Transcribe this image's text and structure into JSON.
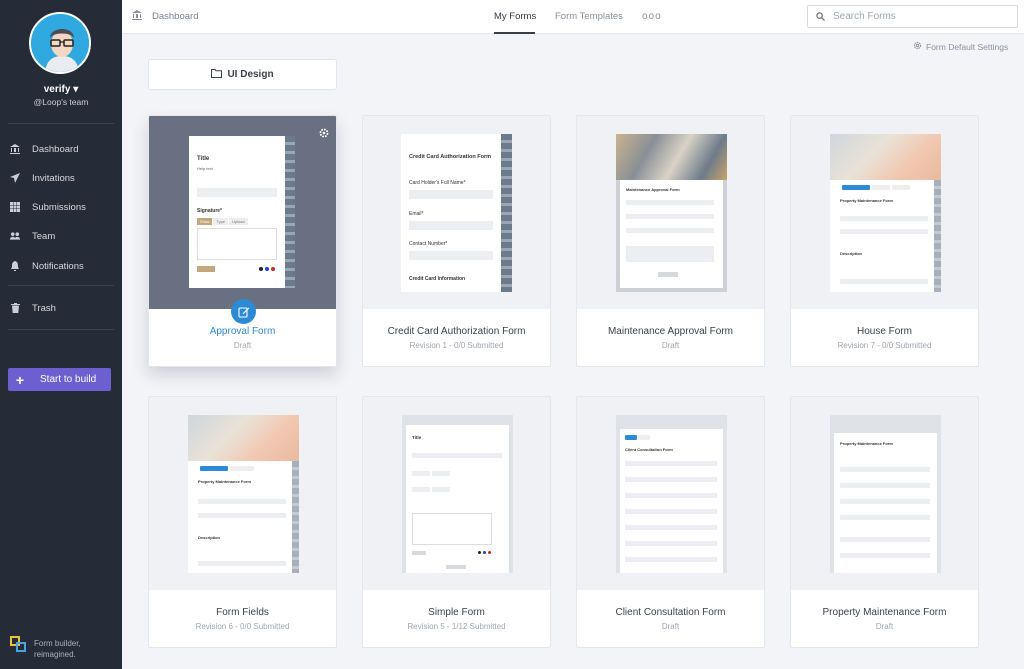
{
  "sidebar": {
    "user_name": "verify",
    "team": "@Loop's team",
    "nav": [
      {
        "label": "Dashboard",
        "icon": "bank-icon"
      },
      {
        "label": "Invitations",
        "icon": "paper-plane-icon"
      },
      {
        "label": "Submissions",
        "icon": "grid-icon"
      },
      {
        "label": "Team",
        "icon": "users-icon"
      },
      {
        "label": "Notifications",
        "icon": "bell-icon"
      },
      {
        "label": "Trash",
        "icon": "trash-icon"
      }
    ],
    "start_button": "Start to build",
    "brand_text_line1": "Form builder,",
    "brand_text_line2": "reimagined."
  },
  "topbar": {
    "breadcrumb": "Dashboard",
    "tabs": [
      "My Forms",
      "Form Templates"
    ],
    "active_tab": "My Forms",
    "more": "ooo",
    "search_placeholder": "Search Forms"
  },
  "toolbar": {
    "defaults_label": "Form Default Settings",
    "folder_label": "UI Design"
  },
  "forms": [
    {
      "title": "Approval Form",
      "subtitle": "Draft"
    },
    {
      "title": "Credit Card Authorization Form",
      "subtitle": "Revision 1 - 0/0 Submitted"
    },
    {
      "title": "Maintenance Approval Form",
      "subtitle": "Draft"
    },
    {
      "title": "House Form",
      "subtitle": "Revision 7 - 0/0 Submitted"
    },
    {
      "title": "Form Fields",
      "subtitle": "Revision 6 - 0/0 Submitted"
    },
    {
      "title": "Simple Form",
      "subtitle": "Revision 5 - 1/12 Submitted"
    },
    {
      "title": "Client Consultation Form",
      "subtitle": "Draft"
    },
    {
      "title": "Property Maintenance Form",
      "subtitle": "Draft"
    }
  ],
  "previews": {
    "approval": {
      "title": "Title",
      "help": "Help text",
      "signature": "Signature*",
      "tabs": [
        "Draw",
        "Type",
        "Upload"
      ]
    },
    "credit": {
      "title": "Credit Card Authorization Form",
      "f1": "Card Holder's Full Name*",
      "f2": "Email*",
      "f3": "Contact Number*",
      "f4": "Credit Card Information"
    },
    "maintenance": {
      "title": "Maintenance Approval Form"
    },
    "house": {
      "title": "Property Maintenance Form",
      "desc": "Description"
    },
    "fields": {
      "title": "Property Maintenance Form",
      "desc": "Description"
    },
    "simple": {
      "title": "Title"
    },
    "client": {
      "title": "Client Consultation Form"
    },
    "property": {
      "title": "Property Maintenance Form"
    }
  },
  "colors": {
    "accent": "#2d8ad4",
    "sidebar": "#262c37",
    "start_button": "#6d5fd0"
  }
}
